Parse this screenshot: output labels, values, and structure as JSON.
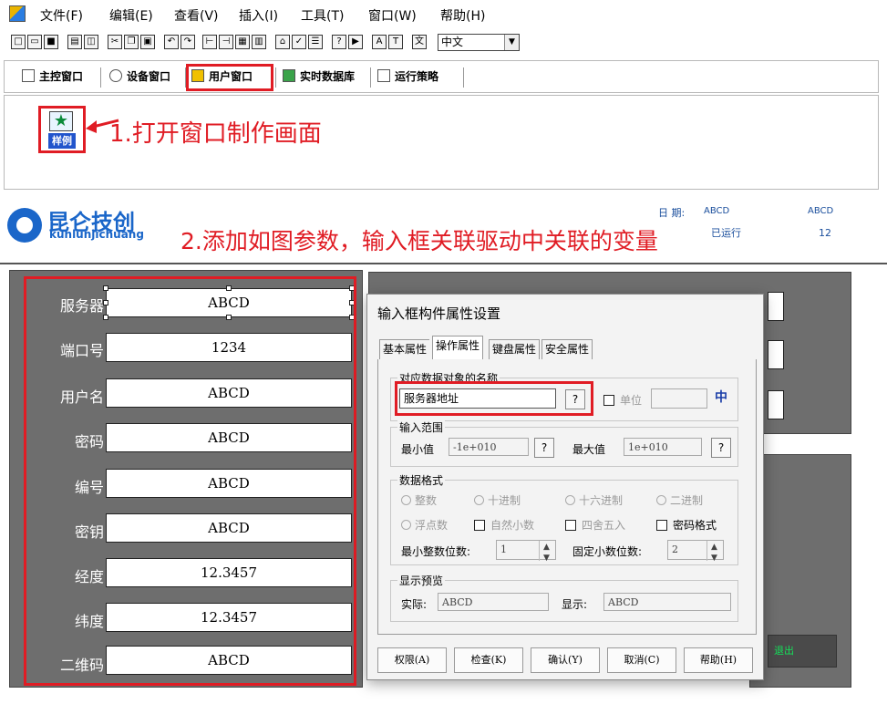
{
  "menu": [
    "文件(F)",
    "编辑(E)",
    "查看(V)",
    "插入(I)",
    "工具(T)",
    "窗口(W)",
    "帮助(H)"
  ],
  "toolbar": {
    "font_value": "中文"
  },
  "window_tabs": [
    "主控窗口",
    "设备窗口",
    "用户窗口",
    "实时数据库",
    "运行策略"
  ],
  "workspace": {
    "sample_icon_label": "样例"
  },
  "annotations": {
    "step1": "1.打开窗口制作画面",
    "step2": "2.添加如图参数，输入框关联驱动中关联的变量"
  },
  "runtime": {
    "logo_cn": "昆仑技创",
    "logo_en": "kunlunjichuang",
    "date_label": "日 期:",
    "date_value": "ABCD",
    "right_value": "ABCD",
    "status_text": "已运行",
    "right_number": "12",
    "exit_label": "退出"
  },
  "params": [
    {
      "label": "服务器",
      "value": "ABCD"
    },
    {
      "label": "端口号",
      "value": "1234"
    },
    {
      "label": "用户名",
      "value": "ABCD"
    },
    {
      "label": "密码",
      "value": "ABCD"
    },
    {
      "label": "编号",
      "value": "ABCD"
    },
    {
      "label": "密钥",
      "value": "ABCD"
    },
    {
      "label": "经度",
      "value": "12.3457"
    },
    {
      "label": "纬度",
      "value": "12.3457"
    },
    {
      "label": "二维码",
      "value": "ABCD"
    }
  ],
  "dialog": {
    "title": "输入框构件属性设置",
    "tabs": [
      "基本属性",
      "操作属性",
      "键盘属性",
      "安全属性"
    ],
    "data_object": {
      "title": "对应数据对象的名称",
      "value": "服务器地址",
      "q": "?",
      "unit_label": "单位",
      "zhong": "中"
    },
    "range": {
      "title": "输入范围",
      "min_label": "最小值",
      "min_value": "-1e+010",
      "max_label": "最大值",
      "max_value": "1e+010",
      "q": "?"
    },
    "format": {
      "title": "数据格式",
      "row1": [
        "整数",
        "十进制",
        "十六进制",
        "二进制"
      ],
      "row2_radio": "浮点数",
      "row2_checks": [
        "自然小数",
        "四舍五入"
      ],
      "password_format": "密码格式",
      "min_int_label": "最小整数位数:",
      "min_int_value": "1",
      "fixed_dec_label": "固定小数位数:",
      "fixed_dec_value": "2"
    },
    "preview": {
      "title": "显示预览",
      "actual_label": "实际:",
      "actual_value": "ABCD",
      "display_label": "显示:",
      "display_value": "ABCD"
    },
    "buttons": [
      "权限(A)",
      "检查(K)",
      "确认(Y)",
      "取消(C)",
      "帮助(H)"
    ]
  },
  "colors": {
    "annotation_red": "#e01c24",
    "panel_grey": "#6e6e6e",
    "brand_blue": "#1a66c9"
  }
}
